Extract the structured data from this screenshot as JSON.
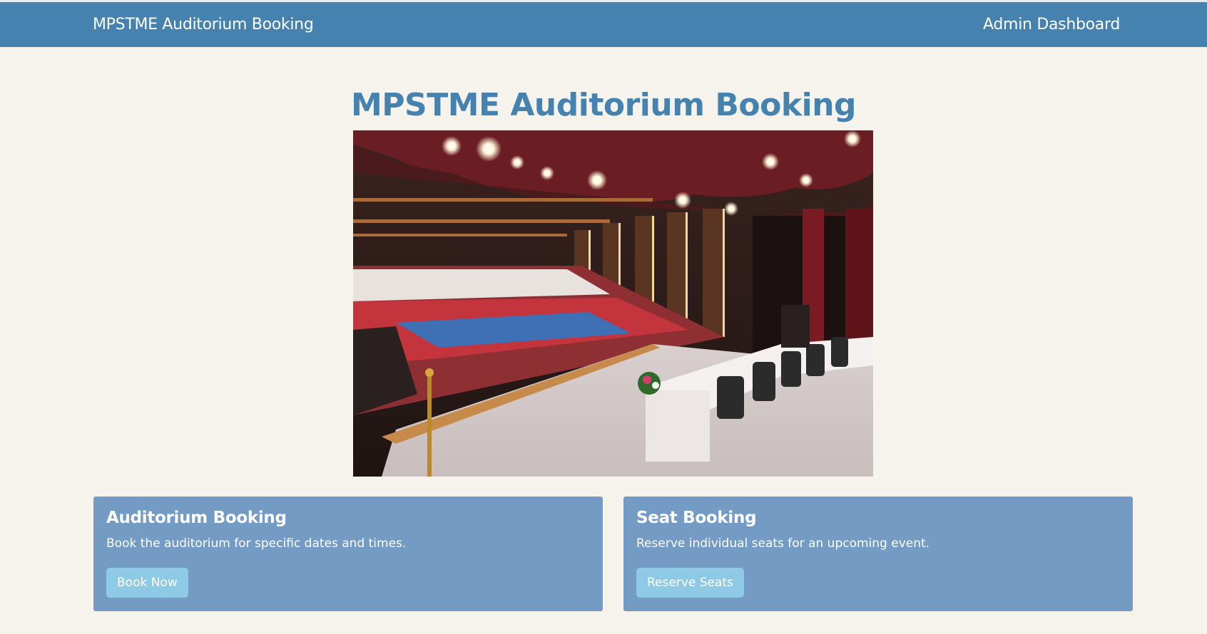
{
  "navbar": {
    "brand": "MPSTME Auditorium Booking",
    "admin_link": "Admin Dashboard"
  },
  "main": {
    "title": "MPSTME Auditorium Booking"
  },
  "cards": [
    {
      "title": "Auditorium Booking",
      "description": "Book the auditorium for specific dates and times.",
      "button": "Book Now"
    },
    {
      "title": "Seat Booking",
      "description": "Reserve individual seats for an upcoming event.",
      "button": "Reserve Seats"
    }
  ],
  "colors": {
    "navbar": "#4682b0",
    "background": "#f5f3ec",
    "card": "#739bc4",
    "button": "#8ecae6"
  }
}
